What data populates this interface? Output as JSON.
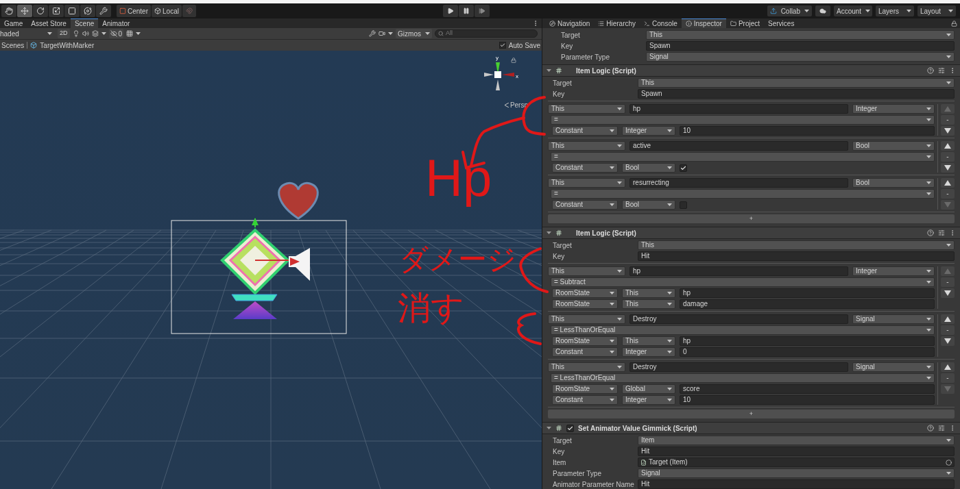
{
  "toolbar": {
    "tools": [
      {
        "kind": "hand",
        "selected": false
      },
      {
        "kind": "move",
        "selected": true
      },
      {
        "kind": "rotate",
        "selected": false
      },
      {
        "kind": "scale",
        "selected": false
      },
      {
        "kind": "rect",
        "selected": false
      },
      {
        "kind": "transform",
        "selected": false
      },
      {
        "kind": "custom",
        "selected": false
      }
    ],
    "pivot_buttons": [
      "Center",
      "Local"
    ],
    "right_menus": [
      "Collab",
      "Account",
      "Layers",
      "Layout"
    ]
  },
  "scene_panel": {
    "tabs": [
      {
        "label": "Game",
        "selected": false
      },
      {
        "label": "Asset Store",
        "selected": false
      },
      {
        "label": "Scene",
        "selected": true
      },
      {
        "label": "Animator",
        "selected": false
      }
    ],
    "shading_mode": "haded",
    "mode_2d": "2D",
    "hidden_count": "0",
    "gizmos": "Gizmos",
    "search": {
      "placeholder": "All"
    },
    "breadcrumb": [
      "Scenes",
      "TargetWithMarker"
    ],
    "auto_save": {
      "label": "Auto Save",
      "checked": true
    },
    "gizmo_axes": {
      "y": "y",
      "x": "x"
    },
    "projection": "Persp"
  },
  "annotations": [
    {
      "text": "Hp"
    },
    {
      "text": "ダメージ"
    },
    {
      "text": "消す"
    }
  ],
  "inspector": {
    "tabs": [
      {
        "label": "Navigation",
        "selected": false
      },
      {
        "label": "Hierarchy",
        "selected": false
      },
      {
        "label": "Console",
        "selected": false
      },
      {
        "label": "Inspector",
        "selected": true
      },
      {
        "label": "Project",
        "selected": false
      },
      {
        "label": "Services",
        "selected": false
      }
    ],
    "top_fields": [
      {
        "label": "Target",
        "value": "This",
        "kind": "dropdown"
      },
      {
        "label": "Key",
        "value": "Spawn",
        "kind": "text"
      },
      {
        "label": "Parameter Type",
        "value": "Signal",
        "kind": "dropdown"
      }
    ],
    "components": [
      {
        "title": "Item Logic (Script)",
        "fields": [
          {
            "label": "Target",
            "value": "This",
            "kind": "dropdown"
          },
          {
            "label": "Key",
            "value": "Spawn",
            "kind": "text"
          }
        ],
        "conditions": [
          {
            "target": "This",
            "name": "hp",
            "type": "Integer",
            "operator": "=",
            "operands": [
              {
                "source": "Constant",
                "scope": "Integer",
                "kind": "field",
                "value": "10"
              }
            ],
            "remove": "-",
            "up_disabled": true,
            "down_disabled": false
          },
          {
            "target": "This",
            "name": "active",
            "type": "Bool",
            "operator": "=",
            "operands": [
              {
                "source": "Constant",
                "scope": "Bool",
                "kind": "checkbox",
                "checked": true
              }
            ],
            "remove": "-",
            "up_disabled": false,
            "down_disabled": false
          },
          {
            "target": "This",
            "name": "resurrecting",
            "type": "Bool",
            "operator": "=",
            "operands": [
              {
                "source": "Constant",
                "scope": "Bool",
                "kind": "checkbox",
                "checked": false
              }
            ],
            "remove": "-",
            "up_disabled": false,
            "down_disabled": true
          }
        ],
        "add_label": "+"
      },
      {
        "title": "Item Logic (Script)",
        "fields": [
          {
            "label": "Target",
            "value": "This",
            "kind": "dropdown"
          },
          {
            "label": "Key",
            "value": "Hit",
            "kind": "text"
          }
        ],
        "conditions": [
          {
            "target": "This",
            "name": "hp",
            "type": "Integer",
            "operator": "= Subtract",
            "operands": [
              {
                "source": "RoomState",
                "scope": "This",
                "kind": "field",
                "value": "hp"
              },
              {
                "source": "RoomState",
                "scope": "This",
                "kind": "field",
                "value": "damage"
              }
            ],
            "remove": "-",
            "up_disabled": true,
            "down_disabled": false
          },
          {
            "target": "This",
            "name": "Destroy",
            "type": "Signal",
            "operator": "= LessThanOrEqual",
            "operands": [
              {
                "source": "RoomState",
                "scope": "This",
                "kind": "field",
                "value": "hp"
              },
              {
                "source": "Constant",
                "scope": "Integer",
                "kind": "field",
                "value": "0"
              }
            ],
            "remove": "-",
            "up_disabled": false,
            "down_disabled": false
          },
          {
            "target": "This",
            "name": "Destroy",
            "type": "Signal",
            "operator": "= LessThanOrEqual",
            "operands": [
              {
                "source": "RoomState",
                "scope": "Global",
                "kind": "field",
                "value": "score"
              },
              {
                "source": "Constant",
                "scope": "Integer",
                "kind": "field",
                "value": "10"
              }
            ],
            "remove": "-",
            "up_disabled": false,
            "down_disabled": true
          }
        ],
        "add_label": "+"
      },
      {
        "title": "Set Animator Value Gimmick (Script)",
        "checked": true,
        "fields": [
          {
            "label": "Target",
            "value": "Item",
            "kind": "dropdown"
          },
          {
            "label": "Key",
            "value": "Hit",
            "kind": "text"
          },
          {
            "label": "Item",
            "value": "Target (Item)",
            "kind": "object"
          },
          {
            "label": "Parameter Type",
            "value": "Signal",
            "kind": "dropdown"
          },
          {
            "label": "Animator Parameter Name",
            "value": "Hit",
            "kind": "text"
          }
        ]
      }
    ]
  }
}
